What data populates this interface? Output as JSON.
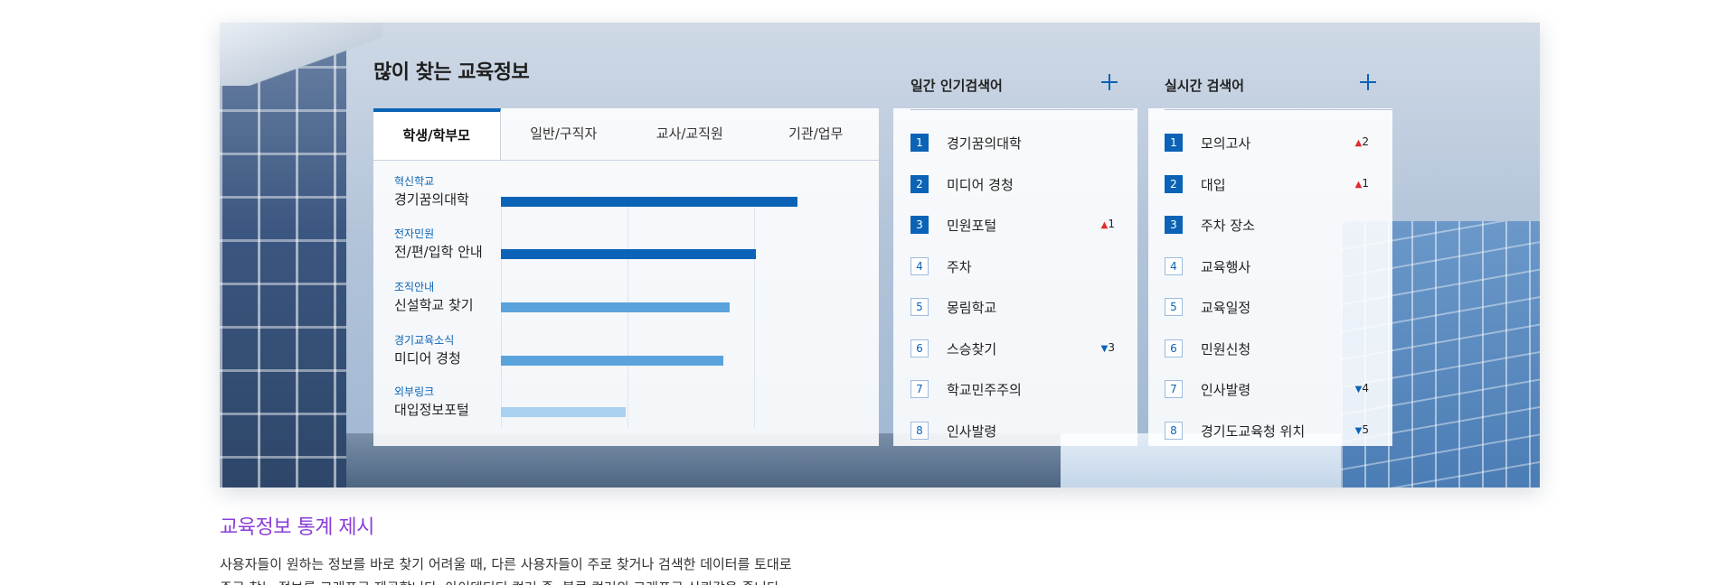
{
  "section_title": "많이 찾는 교육정보",
  "tabs": [
    {
      "label": "학생/학부모",
      "active": true
    },
    {
      "label": "일반/구직자",
      "active": false
    },
    {
      "label": "교사/교직원",
      "active": false
    },
    {
      "label": "기관/업무",
      "active": false
    }
  ],
  "bar_items": [
    {
      "category": "혁신학교",
      "label": "경기꿈의대학",
      "value": 100,
      "color": "#0a63b6"
    },
    {
      "category": "전자민원",
      "label": "전/편/입학 안내",
      "value": 86,
      "color": "#0a63b6"
    },
    {
      "category": "조직안내",
      "label": "신설학교 찾기",
      "value": 77,
      "color": "#5aa3dc"
    },
    {
      "category": "경기교육소식",
      "label": "미디어 경청",
      "value": 75,
      "color": "#5aa3dc"
    },
    {
      "category": "외부링크",
      "label": "대입정보포털",
      "value": 42,
      "color": "#a9d0ef"
    }
  ],
  "weekly": {
    "title": "일간 인기검색어",
    "items": [
      {
        "rank": "1",
        "text": "경기꿈의대학",
        "change": "",
        "dir": ""
      },
      {
        "rank": "2",
        "text": "미디어 경청",
        "change": "",
        "dir": ""
      },
      {
        "rank": "3",
        "text": "민원포털",
        "change": "1",
        "dir": "up"
      },
      {
        "rank": "4",
        "text": "주차",
        "change": "",
        "dir": ""
      },
      {
        "rank": "5",
        "text": "몽림학교",
        "change": "",
        "dir": ""
      },
      {
        "rank": "6",
        "text": "스승찾기",
        "change": "3",
        "dir": "down"
      },
      {
        "rank": "7",
        "text": "학교민주주의",
        "change": "",
        "dir": ""
      },
      {
        "rank": "8",
        "text": "인사발령",
        "change": "",
        "dir": ""
      }
    ]
  },
  "realtime": {
    "title": "실시간 검색어",
    "items": [
      {
        "rank": "1",
        "text": "모의고사",
        "change": "2",
        "dir": "up"
      },
      {
        "rank": "2",
        "text": "대입",
        "change": "1",
        "dir": "up"
      },
      {
        "rank": "3",
        "text": "주차 장소",
        "change": "",
        "dir": ""
      },
      {
        "rank": "4",
        "text": "교육행사",
        "change": "",
        "dir": ""
      },
      {
        "rank": "5",
        "text": "교육일정",
        "change": "",
        "dir": ""
      },
      {
        "rank": "6",
        "text": "민원신청",
        "change": "",
        "dir": ""
      },
      {
        "rank": "7",
        "text": "인사발령",
        "change": "4",
        "dir": "down"
      },
      {
        "rank": "8",
        "text": "경기도교육청 위치",
        "change": "5",
        "dir": "down"
      }
    ]
  },
  "description": {
    "title": "교육정보 통계 제시",
    "line1": "사용자들이 원하는 정보를 바로 찾기 어려울 때, 다른 사용자들이 주로 찾거나 검색한 데이터를 토대로",
    "line2": "주로 찾는 정보를 그래프로 제공합니다. 아이덴티티 컬러 중, 블루 컬러의 그래프로 신뢰감을 줍니다."
  }
}
